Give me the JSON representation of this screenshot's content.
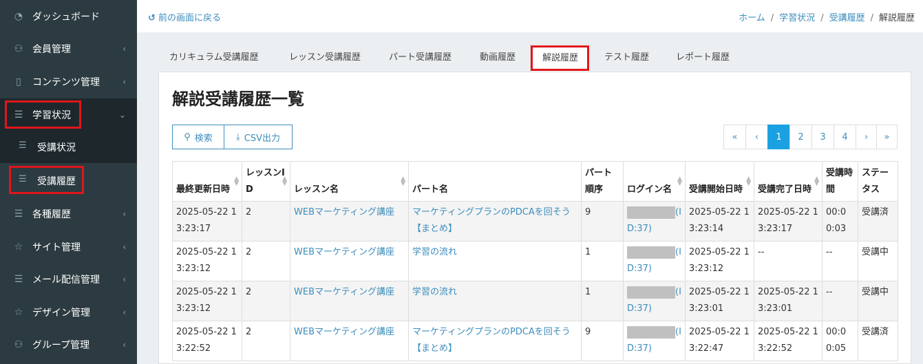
{
  "sidebar": {
    "items": [
      {
        "label": "ダッシュボード",
        "icon": "dashboard-icon",
        "chev": ""
      },
      {
        "label": "会員管理",
        "icon": "users-icon",
        "chev": "‹"
      },
      {
        "label": "コンテンツ管理",
        "icon": "book-icon",
        "chev": "‹"
      },
      {
        "label": "学習状況",
        "icon": "list-icon",
        "chev": "⌄"
      },
      {
        "label": "受講状況",
        "icon": "list-icon"
      },
      {
        "label": "受講履歴",
        "icon": "list-icon"
      },
      {
        "label": "各種履歴",
        "icon": "list-icon",
        "chev": "‹"
      },
      {
        "label": "サイト管理",
        "icon": "star-icon",
        "chev": "‹"
      },
      {
        "label": "メール配信管理",
        "icon": "list-icon",
        "chev": "‹"
      },
      {
        "label": "デザイン管理",
        "icon": "star-icon",
        "chev": "‹"
      },
      {
        "label": "グループ管理",
        "icon": "users-icon",
        "chev": "‹"
      }
    ]
  },
  "topbar": {
    "back_label": "前の画面に戻る",
    "breadcrumb": [
      "ホーム",
      "学習状況",
      "受講履歴",
      "解説履歴"
    ]
  },
  "tabs": [
    "カリキュラム受講履歴",
    "レッスン受講履歴",
    "パート受講履歴",
    "動画履歴",
    "解説履歴",
    "テスト履歴",
    "レポート履歴"
  ],
  "active_tab": "解説履歴",
  "page_title": "解説受講履歴一覧",
  "buttons": {
    "search": "検索",
    "csv": "CSV出力"
  },
  "pagination": [
    "«",
    "‹",
    "1",
    "2",
    "3",
    "4",
    "›",
    "»"
  ],
  "current_page": "1",
  "table": {
    "headers": [
      "最終更新日時",
      "レッスンID",
      "レッスン名",
      "パート名",
      "パート順序",
      "ログイン名",
      "受講開始日時",
      "受講完了日時",
      "受講時間",
      "ステータス"
    ],
    "rows": [
      {
        "updated": "2025-05-22 13:23:17",
        "lesson_id": "2",
        "lesson": "WEBマーケティング講座",
        "part": "マーケティングプランのPDCAを回そう【まとめ】",
        "order": "9",
        "login": "(ID:37)",
        "start": "2025-05-22 13:23:14",
        "end": "2025-05-22 13:23:17",
        "time": "00:00:03",
        "status": "受講済"
      },
      {
        "updated": "2025-05-22 13:23:12",
        "lesson_id": "2",
        "lesson": "WEBマーケティング講座",
        "part": "学習の流れ",
        "order": "1",
        "login": "(ID:37)",
        "start": "2025-05-22 13:23:12",
        "end": "--",
        "time": "--",
        "status": "受講中"
      },
      {
        "updated": "2025-05-22 13:23:12",
        "lesson_id": "2",
        "lesson": "WEBマーケティング講座",
        "part": "学習の流れ",
        "order": "1",
        "login": "(ID:37)",
        "start": "2025-05-22 13:23:01",
        "end": "2025-05-22 13:23:01",
        "time": "--",
        "status": "受講中"
      },
      {
        "updated": "2025-05-22 13:22:52",
        "lesson_id": "2",
        "lesson": "WEBマーケティング講座",
        "part": "マーケティングプランのPDCAを回そう【まとめ】",
        "order": "9",
        "login": "(ID:37)",
        "start": "2025-05-22 13:22:47",
        "end": "2025-05-22 13:22:52",
        "time": "00:00:05",
        "status": "受講済"
      }
    ]
  },
  "colors": {
    "sidebar": "#2c3b41",
    "accent": "#3c8dbc",
    "highlight": "#e0161b",
    "page_active": "#1ba1e2"
  }
}
